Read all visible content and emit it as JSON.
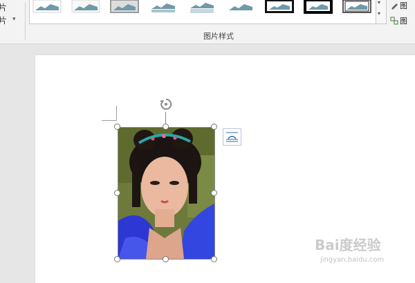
{
  "ribbon": {
    "left_cut_items": [
      "片",
      "片"
    ],
    "group_label": "图片样式",
    "right_commands": [
      "图",
      "图"
    ],
    "gallery": {
      "styles": [
        "simple-frame-white",
        "soft-edge",
        "shadow-rectangle",
        "reflected",
        "reflected-rounded",
        "plain",
        "thick-black-frame",
        "black-frame-shadow",
        "double-frame-black"
      ],
      "more_label": "▾"
    }
  },
  "document": {
    "picture": {
      "subject": "portrait-photo",
      "selected": true
    }
  },
  "watermark": {
    "brand": "Bai度经验",
    "url": "jingyan.baidu.com"
  },
  "colors": {
    "accent": "#5f8fa6",
    "selection": "#8c8c8c"
  }
}
